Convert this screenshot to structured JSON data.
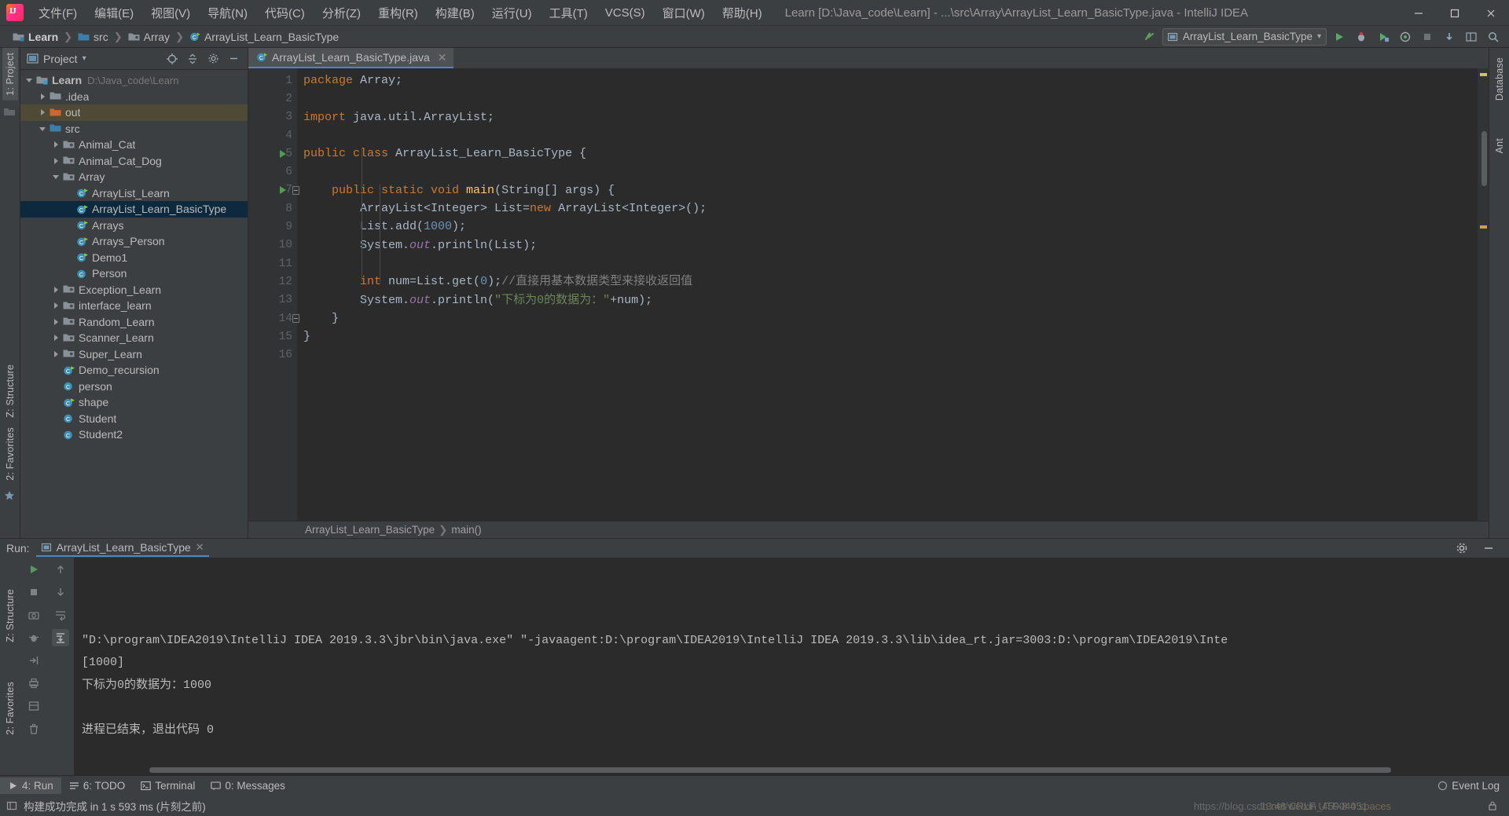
{
  "window": {
    "title": "Learn [D:\\Java_code\\Learn] - ...\\src\\Array\\ArrayList_Learn_BasicType.java - IntelliJ IDEA",
    "minimize": "—",
    "maximize": "❐",
    "close": "✕"
  },
  "menu": [
    {
      "label": "文件(F)"
    },
    {
      "label": "编辑(E)"
    },
    {
      "label": "视图(V)"
    },
    {
      "label": "导航(N)"
    },
    {
      "label": "代码(C)"
    },
    {
      "label": "分析(Z)"
    },
    {
      "label": "重构(R)"
    },
    {
      "label": "构建(B)"
    },
    {
      "label": "运行(U)"
    },
    {
      "label": "工具(T)"
    },
    {
      "label": "VCS(S)"
    },
    {
      "label": "窗口(W)"
    },
    {
      "label": "帮助(H)"
    }
  ],
  "navbar": {
    "crumbs": [
      {
        "label": "Learn",
        "icon": "module-folder-icon"
      },
      {
        "label": "src",
        "icon": "source-folder-icon"
      },
      {
        "label": "Array",
        "icon": "package-folder-icon"
      },
      {
        "label": "ArrayList_Learn_BasicType",
        "icon": "java-class-icon"
      }
    ],
    "separator": "❯",
    "run_config": "ArrayList_Learn_BasicType",
    "run_config_caret": "▾",
    "buttons": [
      {
        "name": "run-button",
        "glyph": "▶"
      },
      {
        "name": "debug-button",
        "glyph": "🐞"
      },
      {
        "name": "run-with-coverage-button",
        "glyph": "▶"
      },
      {
        "name": "profiler-button",
        "glyph": "◎"
      },
      {
        "name": "stop-button",
        "glyph": "■"
      },
      {
        "name": "update-project-button",
        "glyph": "⭳"
      },
      {
        "name": "layout-button",
        "glyph": "▥"
      },
      {
        "name": "search-everywhere-button",
        "glyph": "🔍"
      }
    ]
  },
  "left_rail": {
    "project_tab": "1: Project",
    "structure_tab": "Z: Structure",
    "favorites_tab": "2: Favorites"
  },
  "right_rail": {
    "database_tab": "Database",
    "ant_tab": "Ant"
  },
  "project_panel": {
    "title": "Project",
    "caret": "▾",
    "tree": [
      {
        "label": "Learn",
        "path": "D:\\Java_code\\Learn",
        "depth": 0,
        "arrow": "down",
        "icon": "module-folder-icon",
        "bold": true,
        "state": "normal"
      },
      {
        "label": ".idea",
        "depth": 1,
        "arrow": "right",
        "icon": "folder-icon",
        "state": "normal"
      },
      {
        "label": "out",
        "depth": 1,
        "arrow": "right",
        "icon": "excluded-folder-icon",
        "state": "highlight"
      },
      {
        "label": "src",
        "depth": 1,
        "arrow": "down",
        "icon": "source-folder-icon",
        "state": "normal"
      },
      {
        "label": "Animal_Cat",
        "depth": 2,
        "arrow": "right",
        "icon": "package-folder-icon",
        "state": "normal"
      },
      {
        "label": "Animal_Cat_Dog",
        "depth": 2,
        "arrow": "right",
        "icon": "package-folder-icon",
        "state": "normal"
      },
      {
        "label": "Array",
        "depth": 2,
        "arrow": "down",
        "icon": "package-folder-icon",
        "state": "normal"
      },
      {
        "label": "ArrayList_Learn",
        "depth": 3,
        "arrow": "none",
        "icon": "runnable-class-icon",
        "state": "normal"
      },
      {
        "label": "ArrayList_Learn_BasicType",
        "depth": 3,
        "arrow": "none",
        "icon": "runnable-class-icon",
        "state": "selected"
      },
      {
        "label": "Arrays",
        "depth": 3,
        "arrow": "none",
        "icon": "runnable-class-icon",
        "state": "normal"
      },
      {
        "label": "Arrays_Person",
        "depth": 3,
        "arrow": "none",
        "icon": "runnable-class-icon",
        "state": "normal"
      },
      {
        "label": "Demo1",
        "depth": 3,
        "arrow": "none",
        "icon": "runnable-class-icon",
        "state": "normal"
      },
      {
        "label": "Person",
        "depth": 3,
        "arrow": "none",
        "icon": "class-icon",
        "state": "normal"
      },
      {
        "label": "Exception_Learn",
        "depth": 2,
        "arrow": "right",
        "icon": "package-folder-icon",
        "state": "normal"
      },
      {
        "label": "interface_learn",
        "depth": 2,
        "arrow": "right",
        "icon": "package-folder-icon",
        "state": "normal"
      },
      {
        "label": "Random_Learn",
        "depth": 2,
        "arrow": "right",
        "icon": "package-folder-icon",
        "state": "normal"
      },
      {
        "label": "Scanner_Learn",
        "depth": 2,
        "arrow": "right",
        "icon": "package-folder-icon",
        "state": "normal"
      },
      {
        "label": "Super_Learn",
        "depth": 2,
        "arrow": "right",
        "icon": "package-folder-icon",
        "state": "normal"
      },
      {
        "label": "Demo_recursion",
        "depth": 2,
        "arrow": "none",
        "icon": "runnable-class-icon",
        "state": "normal"
      },
      {
        "label": "person",
        "depth": 2,
        "arrow": "none",
        "icon": "class-icon",
        "state": "normal"
      },
      {
        "label": "shape",
        "depth": 2,
        "arrow": "none",
        "icon": "runnable-class-icon",
        "state": "normal"
      },
      {
        "label": "Student",
        "depth": 2,
        "arrow": "none",
        "icon": "class-icon",
        "state": "normal"
      },
      {
        "label": "Student2",
        "depth": 2,
        "arrow": "none",
        "icon": "class-icon",
        "state": "normal"
      }
    ]
  },
  "editor": {
    "tab": {
      "label": "ArrayList_Learn_BasicType.java",
      "close": "✕",
      "icon": "java-class-icon"
    },
    "line_numbers": [
      "1",
      "2",
      "3",
      "4",
      "5",
      "6",
      "7",
      "8",
      "9",
      "10",
      "11",
      "12",
      "13",
      "14",
      "15",
      "16"
    ],
    "lines": [
      {
        "n": 1,
        "tokens": [
          {
            "t": "package ",
            "c": "kw"
          },
          {
            "t": "Array;",
            "c": "plain"
          }
        ],
        "indent": 0
      },
      {
        "n": 2,
        "tokens": [],
        "indent": 0
      },
      {
        "n": 3,
        "tokens": [
          {
            "t": "import ",
            "c": "kw"
          },
          {
            "t": "java.util.ArrayList;",
            "c": "plain"
          }
        ],
        "indent": 0
      },
      {
        "n": 4,
        "tokens": [],
        "indent": 0
      },
      {
        "n": 5,
        "tokens": [
          {
            "t": "public class ",
            "c": "kw"
          },
          {
            "t": "ArrayList_Learn_BasicType {",
            "c": "plain"
          }
        ],
        "indent": 0,
        "gutter": "run"
      },
      {
        "n": 6,
        "tokens": [],
        "indent": 0
      },
      {
        "n": 7,
        "tokens": [
          {
            "t": "    ",
            "c": "plain"
          },
          {
            "t": "public static void ",
            "c": "kw"
          },
          {
            "t": "main",
            "c": "fn"
          },
          {
            "t": "(String[] args) {",
            "c": "plain"
          }
        ],
        "indent": 0,
        "gutter": "run-fold"
      },
      {
        "n": 8,
        "tokens": [
          {
            "t": "        ArrayList<Integer> List=",
            "c": "plain"
          },
          {
            "t": "new ",
            "c": "kw"
          },
          {
            "t": "ArrayList<",
            "c": "plain"
          },
          {
            "t": "Integer",
            "c": "fld-plain"
          },
          {
            "t": ">();",
            "c": "plain"
          }
        ],
        "indent": 1
      },
      {
        "n": 9,
        "tokens": [
          {
            "t": "        List.add(",
            "c": "plain"
          },
          {
            "t": "1000",
            "c": "num"
          },
          {
            "t": ");",
            "c": "plain"
          }
        ],
        "indent": 1
      },
      {
        "n": 10,
        "tokens": [
          {
            "t": "        System.",
            "c": "plain"
          },
          {
            "t": "out",
            "c": "fld"
          },
          {
            "t": ".println(List);",
            "c": "plain"
          }
        ],
        "indent": 1
      },
      {
        "n": 11,
        "tokens": [],
        "indent": 1
      },
      {
        "n": 12,
        "tokens": [
          {
            "t": "        ",
            "c": "plain"
          },
          {
            "t": "int ",
            "c": "kw"
          },
          {
            "t": "num=List.get(",
            "c": "plain"
          },
          {
            "t": "0",
            "c": "num"
          },
          {
            "t": ");",
            "c": "plain"
          },
          {
            "t": "//直接用基本数据类型来接收返回值",
            "c": "cmt"
          }
        ],
        "indent": 1
      },
      {
        "n": 13,
        "tokens": [
          {
            "t": "        System.",
            "c": "plain"
          },
          {
            "t": "out",
            "c": "fld"
          },
          {
            "t": ".println(",
            "c": "plain"
          },
          {
            "t": "\"下标为0的数据为：\"",
            "c": "str"
          },
          {
            "t": "+num);",
            "c": "plain"
          }
        ],
        "indent": 1
      },
      {
        "n": 14,
        "tokens": [
          {
            "t": "    }",
            "c": "plain"
          }
        ],
        "indent": 0,
        "gutter": "fold-end"
      },
      {
        "n": 15,
        "tokens": [
          {
            "t": "}",
            "c": "plain"
          }
        ],
        "indent": 0
      },
      {
        "n": 16,
        "tokens": [],
        "indent": 0
      }
    ],
    "breadcrumb": [
      {
        "label": "ArrayList_Learn_BasicType"
      },
      {
        "label": "main()"
      }
    ],
    "breadcrumb_sep": "❯"
  },
  "run_panel": {
    "label": "Run:",
    "tab": "ArrayList_Learn_BasicType",
    "tab_close": "✕",
    "settings_icon": "gear-icon",
    "minimize_icon": "minimize-icon",
    "console_lines": [
      "\"D:\\program\\IDEA2019\\IntelliJ IDEA 2019.3.3\\jbr\\bin\\java.exe\" \"-javaagent:D:\\program\\IDEA2019\\IntelliJ IDEA 2019.3.3\\lib\\idea_rt.jar=3003:D:\\program\\IDEA2019\\Inte",
      "[1000]",
      "下标为0的数据为：1000",
      "",
      "进程已结束，退出代码 0"
    ],
    "tools": [
      {
        "name": "rerun-button",
        "glyph": "▶"
      },
      {
        "name": "stop-button",
        "glyph": "■"
      },
      {
        "name": "screenshot-button",
        "glyph": "▣"
      },
      {
        "name": "dump-threads-button",
        "glyph": "⚙"
      },
      {
        "name": "close-button",
        "glyph": "⇥"
      },
      {
        "name": "print-button",
        "glyph": "🖶"
      },
      {
        "name": "toggle-button",
        "glyph": "▤"
      },
      {
        "name": "trash-button",
        "glyph": "🗑"
      }
    ],
    "tools2": [
      {
        "name": "scroll-up-button",
        "glyph": "↑"
      },
      {
        "name": "scroll-down-button",
        "glyph": "↓"
      },
      {
        "name": "soft-wrap-button",
        "glyph": "⏎"
      },
      {
        "name": "scroll-to-end-button",
        "glyph": "⤓"
      }
    ]
  },
  "bottom_tabs": [
    {
      "label": "4: Run",
      "key": "4",
      "icon": "run-icon",
      "active": true
    },
    {
      "label": "6: TODO",
      "key": "6",
      "icon": "todo-icon",
      "active": false
    },
    {
      "label": "Terminal",
      "key": "",
      "icon": "terminal-icon",
      "active": false
    },
    {
      "label": "0: Messages",
      "key": "0",
      "icon": "messages-icon",
      "active": false
    }
  ],
  "status_bar": {
    "message": "构建成功完成 in 1 s 593 ms (片刻之前)",
    "event_log": "Event Log",
    "event_log_icon": "event-log-icon",
    "watermark": "https://blog.csdn.net/weixin_45904051",
    "watermark2": "13:48 CRLF UTF-8 4 spaces"
  }
}
